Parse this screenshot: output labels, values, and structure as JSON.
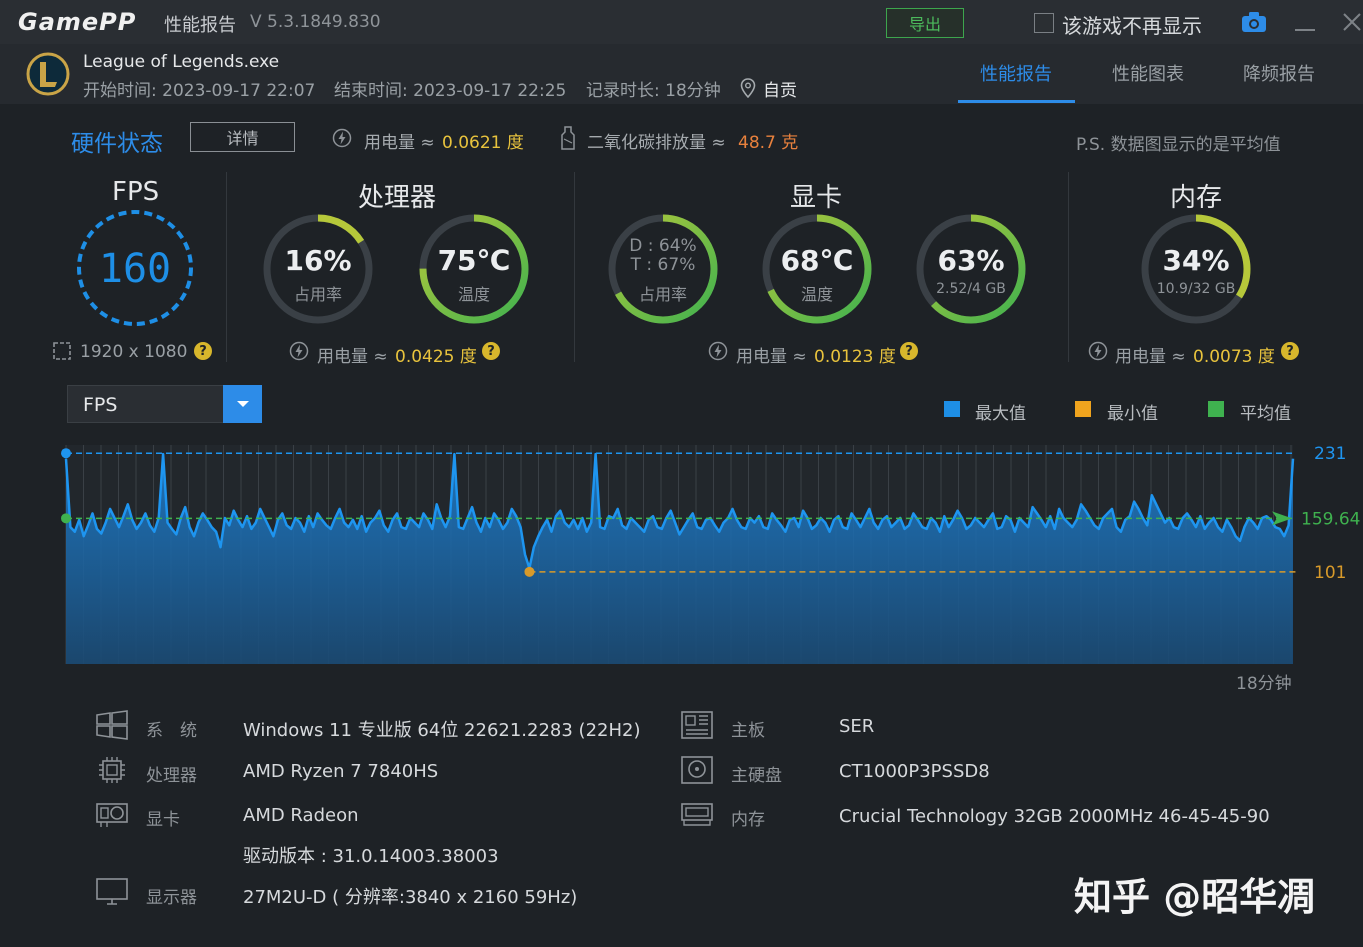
{
  "titlebar": {
    "logo": "GamePP",
    "title": "性能报告",
    "version": "V 5.3.1849.830",
    "export_label": "导出",
    "hide_label": "该游戏不再显示"
  },
  "header": {
    "game_name": "League of Legends.exe",
    "start_time": "开始时间: 2023-09-17 22:07",
    "end_time": "结束时间: 2023-09-17 22:25",
    "duration": "记录时长: 18分钟",
    "location": "自贡",
    "tabs": [
      {
        "label": "性能报告",
        "active": true
      },
      {
        "label": "性能图表",
        "active": false
      },
      {
        "label": "降频报告",
        "active": false
      }
    ]
  },
  "hardware": {
    "title": "硬件状态",
    "detail_label": "详情",
    "power_label": "用电量 ≈",
    "power_value": "0.0621 度",
    "co2_label": "二氧化碳排放量 ≈",
    "co2_value": "48.7 克",
    "ps_note": "P.S. 数据图显示的是平均值"
  },
  "sections": {
    "fps": {
      "title": "FPS",
      "value": "160",
      "resolution": "1920 x 1080"
    },
    "cpu": {
      "title": "处理器",
      "usage": {
        "main": "16%",
        "sub": "占用率",
        "level": 0.16
      },
      "temp": {
        "main": "75℃",
        "sub": "温度",
        "level": 0.75
      },
      "power_label": "用电量 ≈",
      "power_value": "0.0425 度"
    },
    "gpu": {
      "title": "显卡",
      "usage": {
        "line1": "D : 64%",
        "line2": "T : 67%",
        "sub": "占用率",
        "level": 0.67
      },
      "temp": {
        "main": "68℃",
        "sub": "温度",
        "level": 0.68
      },
      "vram": {
        "main": "63%",
        "sub": "2.52/4 GB",
        "level": 0.63
      },
      "power_label": "用电量 ≈",
      "power_value": "0.0123 度"
    },
    "ram": {
      "title": "内存",
      "usage": {
        "main": "34%",
        "sub": "10.9/32 GB",
        "level": 0.34
      },
      "power_label": "用电量 ≈",
      "power_value": "0.0073 度"
    }
  },
  "chart_controls": {
    "metric": "FPS",
    "legend": [
      {
        "label": "最大值",
        "color": "#1e8fe6"
      },
      {
        "label": "最小值",
        "color": "#f0a41e"
      },
      {
        "label": "平均值",
        "color": "#3fb24f"
      }
    ]
  },
  "chart_data": {
    "type": "area",
    "metric": "FPS",
    "max": 231,
    "min": 101,
    "avg": 159.64,
    "max_label": "231",
    "min_label": "101",
    "avg_label": "159.64",
    "x_end_label": "18分钟",
    "ylim": [
      0,
      240
    ],
    "grid": true,
    "values": [
      225,
      150,
      145,
      158,
      140,
      152,
      165,
      148,
      143,
      155,
      170,
      160,
      150,
      162,
      175,
      158,
      148,
      155,
      165,
      152,
      145,
      160,
      230,
      155,
      148,
      142,
      160,
      172,
      150,
      140,
      155,
      165,
      158,
      150,
      145,
      128,
      160,
      152,
      168,
      158,
      150,
      162,
      148,
      155,
      170,
      160,
      150,
      140,
      158,
      165,
      152,
      148,
      160,
      155,
      145,
      162,
      150,
      165,
      158,
      152,
      148,
      160,
      170,
      155,
      150,
      158,
      148,
      162,
      145,
      155,
      160,
      168,
      152,
      145,
      158,
      165,
      150,
      148,
      160,
      155,
      150,
      165,
      158,
      148,
      175,
      160,
      150,
      162,
      230,
      150,
      148,
      160,
      172,
      155,
      145,
      160,
      150,
      165,
      158,
      148,
      155,
      170,
      162,
      150,
      120,
      105,
      128,
      140,
      150,
      158,
      145,
      162,
      168,
      155,
      150,
      158,
      148,
      160,
      145,
      155,
      230,
      150,
      148,
      162,
      160,
      170,
      152,
      148,
      160,
      155,
      150,
      145,
      158,
      162,
      150,
      148,
      160,
      168,
      155,
      142,
      150,
      158,
      165,
      150,
      148,
      158,
      160,
      152,
      145,
      155,
      160,
      170,
      158,
      150,
      148,
      160,
      155,
      162,
      150,
      148,
      165,
      158,
      152,
      145,
      158,
      160,
      150,
      168,
      160,
      148,
      152,
      160,
      155,
      145,
      158,
      162,
      150,
      148,
      165,
      158,
      150,
      160,
      170,
      155,
      148,
      158,
      162,
      150,
      155,
      160,
      148,
      152,
      165,
      158,
      150,
      148,
      160,
      155,
      145,
      162,
      150,
      158,
      168,
      160,
      148,
      152,
      160,
      155,
      150,
      158,
      165,
      148,
      150,
      162,
      158,
      145,
      160,
      155,
      150,
      172,
      165,
      158,
      150,
      162,
      148,
      170,
      160,
      155,
      150,
      158,
      175,
      168,
      160,
      152,
      148,
      160,
      165,
      170,
      150,
      145,
      158,
      162,
      178,
      170,
      160,
      152,
      185,
      175,
      165,
      155,
      160,
      150,
      148,
      160,
      165,
      158,
      150,
      162,
      148,
      155,
      160,
      150,
      145,
      158,
      150,
      140,
      135,
      150,
      160,
      155,
      148,
      160,
      162,
      158,
      150,
      148,
      140,
      152,
      225
    ]
  },
  "system_info": {
    "left": [
      {
        "key": "系　统",
        "value": "Windows 11 专业版 64位 22621.2283 (22H2)"
      },
      {
        "key": "处理器",
        "value": "AMD Ryzen 7 7840HS"
      },
      {
        "key": "显卡",
        "value": "AMD Radeon"
      },
      {
        "key": "",
        "value": "驱动版本 : 31.0.14003.38003"
      },
      {
        "key": "显示器",
        "value": "27M2U-D ( 分辨率:3840 x 2160 59Hz)"
      }
    ],
    "right": [
      {
        "key": "主板",
        "value": "SER"
      },
      {
        "key": "主硬盘",
        "value": "CT1000P3PSSD8"
      },
      {
        "key": "内存",
        "value": "Crucial Technology 32GB 2000MHz 46-45-45-90"
      }
    ]
  },
  "watermark": "知乎 @昭华凋"
}
